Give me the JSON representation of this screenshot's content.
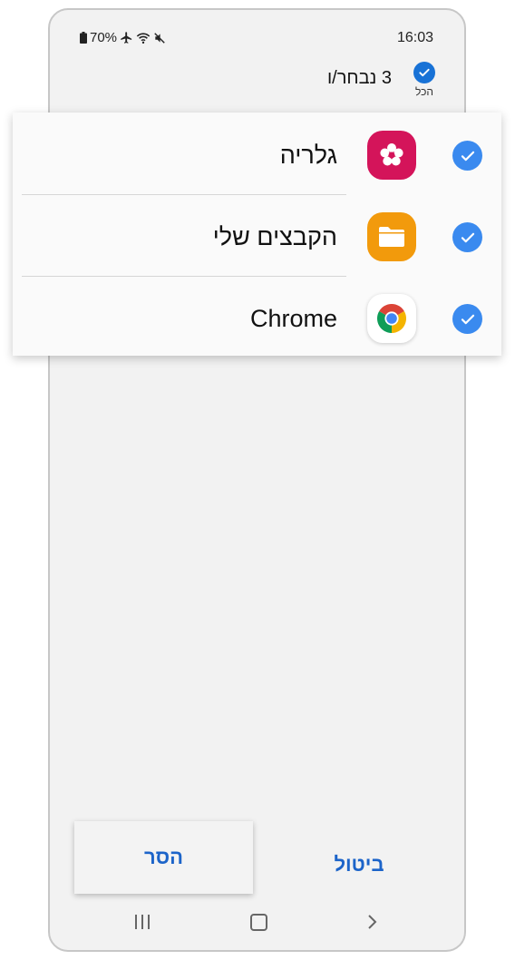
{
  "status_bar": {
    "battery": "70%",
    "time": "16:03"
  },
  "header": {
    "selected_count": "3 נבחר/ו",
    "select_all_label": "הכל"
  },
  "apps": [
    {
      "name": "גלריה",
      "icon": "gallery-icon",
      "icon_color": "#d4145a",
      "checked": true
    },
    {
      "name": "הקבצים שלי",
      "icon": "my-files-icon",
      "icon_color": "#f29a0c",
      "checked": true
    },
    {
      "name": "Chrome",
      "icon": "chrome-icon",
      "checked": true
    }
  ],
  "buttons": {
    "remove": "הסר",
    "cancel": "ביטול"
  },
  "colors": {
    "accent": "#1c64c9",
    "checkbox": "#3a8aef"
  }
}
